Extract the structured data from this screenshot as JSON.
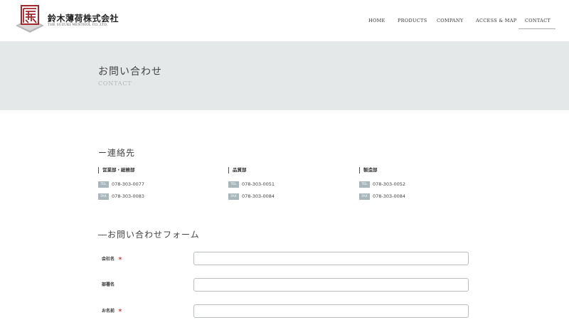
{
  "header": {
    "company_name": "鈴木薄荷株式会社",
    "company_name_en": "THE SUZUKI MENTHOL CO.,LTD.",
    "nav": [
      {
        "label": "HOME"
      },
      {
        "label": "PRODUCTS"
      },
      {
        "label": "COMPANY"
      },
      {
        "label": "ACCESS & MAP"
      },
      {
        "label": "CONTACT",
        "active": true
      }
    ]
  },
  "hero": {
    "title": "お問い合わせ",
    "subtitle": "CONTACT"
  },
  "contacts": {
    "heading": "ー連絡先",
    "departments": [
      {
        "name": "営業部・総務部",
        "tel": "078-303-0077",
        "fax": "078-303-0083"
      },
      {
        "name": "品質部",
        "tel": "078-303-0051",
        "fax": "078-303-0084"
      },
      {
        "name": "製造部",
        "tel": "078-303-0052",
        "fax": "078-303-0084"
      }
    ],
    "tel_label": "TEL",
    "fax_label": "FAX"
  },
  "form": {
    "heading": "―お問い合わせフォーム",
    "required_mark": "＊",
    "fields": [
      {
        "label": "会社名",
        "required": true,
        "value": ""
      },
      {
        "label": "部署名",
        "required": false,
        "value": ""
      },
      {
        "label": "お名前",
        "required": true,
        "value": ""
      }
    ]
  },
  "colors": {
    "hero_bg": "#e4e8e8",
    "badge_bg": "#a8b7bb",
    "logo_red": "#a3262a",
    "required_red": "#cc2222"
  },
  "icons": {
    "logo": "company-logo-icon"
  }
}
